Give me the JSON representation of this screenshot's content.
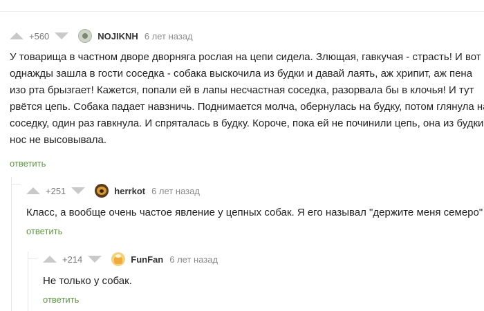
{
  "comments": [
    {
      "rating": "+560",
      "user": "NOJIKNH",
      "time": "6 лет назад",
      "lines": [
        "У товарища в частном дворе дворняга рослая на цепи сидела. Злющая, гавкучая - страсть! И вот",
        "однажды зашла в гости соседка - собака выскочила из будки и давай лаять, аж хрипит, аж пена",
        "изо рта брызгает! Кажется, попали ей в лапы несчастная соседка, разорвала бы в клочья! И тут",
        "рвётся цепь. Собака падает навзничь. Поднимается молча, обернулась на будку, потом глянула на",
        "соседку, один раз гавкнула. И спряталась в будку. Короче, пока ей не починили цепь, она из будки",
        "нос не высовывала."
      ],
      "reply": "ответить"
    },
    {
      "rating": "+251",
      "user": "herrkot",
      "time": "6 лет назад",
      "lines": [
        "Класс, а вообще очень частое явление у цепных собак. Я его называл \"держите меня семеро\""
      ],
      "reply": "ответить"
    },
    {
      "rating": "+214",
      "user": "FunFan",
      "time": "6 лет назад",
      "lines": [
        "Не только у собак."
      ],
      "reply": "ответить"
    }
  ]
}
